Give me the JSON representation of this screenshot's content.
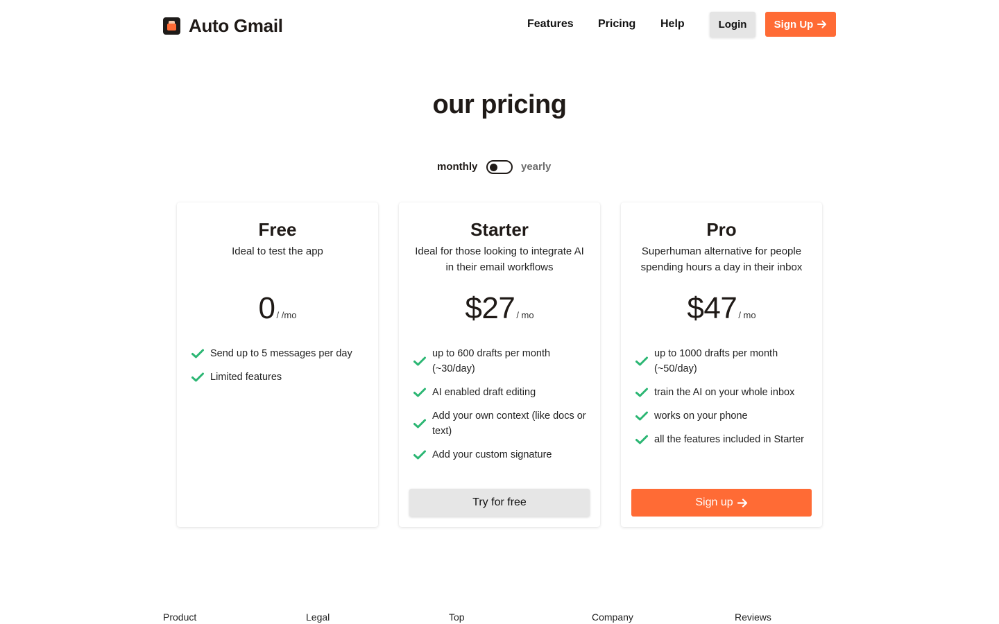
{
  "header": {
    "brand": "Auto Gmail",
    "nav": [
      {
        "label": "Features"
      },
      {
        "label": "Pricing"
      },
      {
        "label": "Help"
      }
    ],
    "login_label": "Login",
    "signup_label": "Sign Up"
  },
  "page": {
    "title": "our pricing"
  },
  "billing": {
    "monthly_label": "monthly",
    "yearly_label": "yearly",
    "selected": "monthly"
  },
  "plans": [
    {
      "name": "Free",
      "description": "Ideal to test the app",
      "price": "0",
      "per": "/ /mo",
      "features": [
        "Send up to 5 messages per day",
        "Limited features"
      ]
    },
    {
      "name": "Starter",
      "description": "Ideal for those looking to integrate AI in their email workflows",
      "price": "$27",
      "per": "/ mo",
      "features": [
        "up to 600 drafts per month (~30/day)",
        "AI enabled draft editing",
        "Add your own context (like docs or text)",
        "Add your custom signature"
      ],
      "cta": "Try for free"
    },
    {
      "name": "Pro",
      "description": "Superhuman alternative for people spending hours a day in their inbox",
      "price": "$47",
      "per": "/ mo",
      "features": [
        "up to 1000 drafts per month (~50/day)",
        "train the AI on your whole inbox",
        "works on your phone",
        "all the features included in Starter"
      ],
      "cta": "Sign up"
    }
  ],
  "footer": {
    "columns": [
      "Product",
      "Legal",
      "Top",
      "Company",
      "Reviews"
    ]
  },
  "colors": {
    "accent": "#ff6b35",
    "check": "#2bb673",
    "text": "#1f1a17"
  },
  "icons": {
    "logo": "mailbox-logo-icon",
    "arrow": "arrow-right-icon",
    "check": "check-icon"
  }
}
